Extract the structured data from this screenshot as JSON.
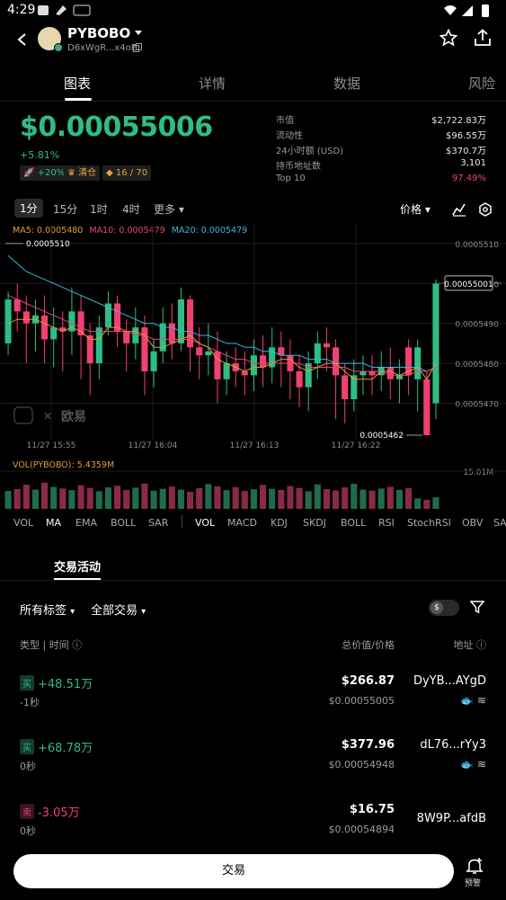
{
  "status": {
    "time": "4:29",
    "icon_names": [
      "media-icon",
      "bird-icon",
      "hms-icon",
      "wifi-icon",
      "signal-icon",
      "battery-icon"
    ]
  },
  "header": {
    "title": "PYBOBO",
    "address": "D6xWgR...x4oE",
    "icons": [
      "back-icon",
      "token-avatar",
      "chevron-down-icon",
      "copy-icon",
      "star-icon",
      "share-icon"
    ]
  },
  "tabs": [
    "图表",
    "详情",
    "数据",
    "风险"
  ],
  "price": {
    "value": "$0.00055006",
    "change": "+5.81%",
    "badges": [
      "+20%",
      "清仓",
      "16 / 70"
    ],
    "accent": "#2ebd85"
  },
  "stats": [
    {
      "label": "市值",
      "value": "$2,722.83万"
    },
    {
      "label": "流动性",
      "value": "$96.55万"
    },
    {
      "label": "24小时额 (USD)",
      "value": "$370.7万"
    },
    {
      "label": "持币地址数",
      "value": "3,101"
    },
    {
      "label": "Top 10",
      "value": "97.49%"
    }
  ],
  "intervals": [
    "1分",
    "15分",
    "1时",
    "4时",
    "更多"
  ],
  "price_mode": "价格",
  "ma_labels": {
    "ma5": "MA5: 0.0005480",
    "ma10": "MA10: 0.0005479",
    "ma20": "MA20: 0.0005479"
  },
  "vol_label": "VOL(PYBOBO): 5.4359M",
  "watermark": "欧易",
  "chart_data": {
    "type": "candlestick",
    "y_ticks": [
      "0.0005510",
      "0.0005500",
      "0.0005490",
      "0.0005480",
      "0.0005470"
    ],
    "ylim": [
      0.0005462,
      0.0005512
    ],
    "x_ticks": [
      "11/27 15:55",
      "11/27 16:04",
      "11/27 16:13",
      "11/27 16:22"
    ],
    "high_label": "0.0005510",
    "low_label": "0.0005462",
    "last_price": "0.00055001",
    "candles": [
      [
        0.0005485,
        0.0005496,
        0.0005498,
        0.0005482,
        1
      ],
      [
        0.0005496,
        0.0005493,
        0.00055,
        0.0005488,
        0
      ],
      [
        0.0005493,
        0.000549,
        0.0005497,
        0.000548,
        0
      ],
      [
        0.000549,
        0.0005492,
        0.0005496,
        0.0005483,
        1
      ],
      [
        0.0005492,
        0.0005486,
        0.0005497,
        0.000548,
        0
      ],
      [
        0.0005486,
        0.0005489,
        0.0005494,
        0.0005479,
        1
      ],
      [
        0.0005489,
        0.0005488,
        0.0005493,
        0.0005478,
        0
      ],
      [
        0.0005488,
        0.0005493,
        0.0005499,
        0.0005482,
        1
      ],
      [
        0.0005493,
        0.0005487,
        0.0005497,
        0.0005476,
        0
      ],
      [
        0.0005487,
        0.000548,
        0.000549,
        0.0005472,
        0
      ],
      [
        0.000548,
        0.0005489,
        0.0005492,
        0.0005476,
        1
      ],
      [
        0.0005489,
        0.0005495,
        0.0005498,
        0.0005487,
        1
      ],
      [
        0.0005495,
        0.0005488,
        0.0005497,
        0.0005484,
        0
      ],
      [
        0.0005488,
        0.0005485,
        0.0005491,
        0.0005478,
        0
      ],
      [
        0.0005485,
        0.0005489,
        0.0005494,
        0.0005481,
        1
      ],
      [
        0.0005489,
        0.0005478,
        0.0005492,
        0.0005472,
        0
      ],
      [
        0.0005478,
        0.0005483,
        0.0005486,
        0.0005474,
        1
      ],
      [
        0.0005483,
        0.000549,
        0.0005494,
        0.000548,
        1
      ],
      [
        0.000549,
        0.0005485,
        0.0005495,
        0.0005481,
        0
      ],
      [
        0.0005485,
        0.0005496,
        0.0005499,
        0.0005483,
        1
      ],
      [
        0.0005496,
        0.0005484,
        0.0005497,
        0.0005478,
        0
      ],
      [
        0.0005484,
        0.0005482,
        0.0005489,
        0.0005476,
        0
      ],
      [
        0.0005482,
        0.0005483,
        0.000549,
        0.0005477,
        1
      ],
      [
        0.0005483,
        0.0005476,
        0.0005488,
        0.000547,
        0
      ],
      [
        0.0005476,
        0.000548,
        0.0005483,
        0.0005472,
        1
      ],
      [
        0.000548,
        0.0005478,
        0.0005484,
        0.0005474,
        0
      ],
      [
        0.0005478,
        0.0005477,
        0.0005483,
        0.0005472,
        0
      ],
      [
        0.0005477,
        0.0005482,
        0.0005486,
        0.0005473,
        1
      ],
      [
        0.0005482,
        0.0005479,
        0.0005487,
        0.0005474,
        0
      ],
      [
        0.0005479,
        0.0005484,
        0.0005489,
        0.0005475,
        1
      ],
      [
        0.0005484,
        0.0005482,
        0.0005488,
        0.0005474,
        0
      ],
      [
        0.0005482,
        0.0005478,
        0.0005486,
        0.0005471,
        0
      ],
      [
        0.0005478,
        0.0005474,
        0.0005482,
        0.0005469,
        0
      ],
      [
        0.0005474,
        0.000548,
        0.0005483,
        0.0005468,
        1
      ],
      [
        0.000548,
        0.0005485,
        0.0005488,
        0.0005476,
        1
      ],
      [
        0.0005485,
        0.0005484,
        0.0005489,
        0.0005478,
        0
      ],
      [
        0.0005484,
        0.0005477,
        0.0005486,
        0.0005466,
        0
      ],
      [
        0.0005477,
        0.0005471,
        0.000548,
        0.0005465,
        0
      ],
      [
        0.0005471,
        0.0005477,
        0.0005481,
        0.0005468,
        1
      ],
      [
        0.0005477,
        0.0005478,
        0.0005482,
        0.0005472,
        1
      ],
      [
        0.0005478,
        0.0005477,
        0.0005482,
        0.0005472,
        0
      ],
      [
        0.0005477,
        0.0005479,
        0.0005483,
        0.0005473,
        1
      ],
      [
        0.0005479,
        0.0005476,
        0.0005484,
        0.0005471,
        0
      ],
      [
        0.0005476,
        0.0005477,
        0.0005481,
        0.000547,
        1
      ],
      [
        0.0005477,
        0.0005484,
        0.0005486,
        0.0005472,
        0
      ],
      [
        0.0005484,
        0.0005476,
        0.0005486,
        0.0005468,
        1
      ],
      [
        0.0005476,
        0.0005462,
        0.0005478,
        0.0005462,
        0
      ],
      [
        0.000547,
        0.00055,
        0.0005501,
        0.0005466,
        1
      ]
    ],
    "ma5": [
      0.000549,
      0.0005491,
      0.0005491,
      0.0005491,
      0.000549,
      0.0005489,
      0.0005488,
      0.0005489,
      0.0005488,
      0.0005486,
      0.0005486,
      0.0005489,
      0.0005489,
      0.0005488,
      0.0005488,
      0.0005487,
      0.0005484,
      0.0005484,
      0.0005485,
      0.0005486,
      0.0005487,
      0.0005485,
      0.0005484,
      0.0005481,
      0.000548,
      0.0005479,
      0.0005478,
      0.0005479,
      0.0005479,
      0.000548,
      0.0005481,
      0.0005481,
      0.0005479,
      0.0005478,
      0.0005479,
      0.000548,
      0.000548,
      0.0005478,
      0.0005476,
      0.0005476,
      0.0005476,
      0.0005478,
      0.0005478,
      0.0005477,
      0.0005478,
      0.0005479,
      0.0005476,
      0.000548
    ],
    "ma10": [
      0.0005497,
      0.0005496,
      0.0005495,
      0.0005494,
      0.0005493,
      0.0005492,
      0.0005491,
      0.000549,
      0.0005489,
      0.0005488,
      0.0005488,
      0.0005488,
      0.0005488,
      0.0005488,
      0.0005487,
      0.0005487,
      0.0005486,
      0.0005486,
      0.0005486,
      0.0005486,
      0.0005486,
      0.0005485,
      0.0005484,
      0.0005483,
      0.0005482,
      0.0005481,
      0.0005481,
      0.000548,
      0.000548,
      0.000548,
      0.000548,
      0.000548,
      0.000548,
      0.0005479,
      0.0005479,
      0.0005479,
      0.0005479,
      0.0005479,
      0.0005478,
      0.0005478,
      0.0005478,
      0.0005478,
      0.0005477,
      0.0005477,
      0.0005477,
      0.0005478,
      0.0005478,
      0.0005479
    ],
    "ma20": [
      0.0005507,
      0.0005505,
      0.0005503,
      0.0005502,
      0.0005501,
      0.00055,
      0.0005499,
      0.0005498,
      0.0005497,
      0.0005496,
      0.0005495,
      0.0005494,
      0.0005493,
      0.0005492,
      0.0005491,
      0.000549,
      0.000549,
      0.0005489,
      0.0005489,
      0.0005488,
      0.0005488,
      0.0005487,
      0.0005487,
      0.0005486,
      0.0005485,
      0.0005485,
      0.0005484,
      0.0005484,
      0.0005483,
      0.0005483,
      0.0005482,
      0.0005482,
      0.0005482,
      0.0005481,
      0.0005481,
      0.0005481,
      0.000548,
      0.000548,
      0.000548,
      0.000548,
      0.0005479,
      0.0005479,
      0.0005479,
      0.0005479,
      0.0005479,
      0.0005479,
      0.0005478,
      0.0005479
    ],
    "vol_tick": "15.01M",
    "volume": [
      6.5,
      7.2,
      8.8,
      7.0,
      9.5,
      8.0,
      7.4,
      6.8,
      8.6,
      7.6,
      6.4,
      7.8,
      8.4,
      6.9,
      7.7,
      9.2,
      6.6,
      7.3,
      8.1,
      7.0,
      6.2,
      7.5,
      9.0,
      8.2,
      6.8,
      7.9,
      6.5,
      7.1,
      8.7,
      7.3,
      6.9,
      8.3,
      7.6,
      6.4,
      8.9,
      7.2,
      6.7,
      7.8,
      9.1,
      7.0,
      6.6,
      7.4,
      8.0,
      6.9,
      7.5,
      3.8,
      3.3,
      4.2
    ]
  },
  "indicators_main": [
    "VOL",
    "MA",
    "EMA",
    "BOLL",
    "SAR"
  ],
  "indicators_sub": [
    "VOL",
    "MACD",
    "KDJ",
    "SKDJ",
    "BOLL",
    "RSI",
    "StochRSI",
    "OBV",
    "SA"
  ],
  "activity": {
    "title": "交易活动",
    "filters": [
      "所有标签",
      "全部交易"
    ],
    "col_type": "类型 | 时间",
    "col_value": "总价值/价格",
    "col_addr": "地址",
    "rows": [
      {
        "side": "买",
        "amount": "+48.51万",
        "ago": "-1秒",
        "total": "$266.87",
        "price": "$0.00055005",
        "addr": "DyYB...AYgD"
      },
      {
        "side": "买",
        "amount": "+68.78万",
        "ago": "0秒",
        "total": "$377.96",
        "price": "$0.00054948",
        "addr": "dL76...rYy3"
      },
      {
        "side": "卖",
        "amount": "-3.05万",
        "ago": "0秒",
        "total": "$16.75",
        "price": "$0.00054894",
        "addr": "8W9P...afdB"
      }
    ]
  },
  "bottom": {
    "trade": "交易",
    "alert": "预警"
  },
  "colors": {
    "up": "#2ebd85",
    "down": "#f0416f",
    "ma5": "#e59a34",
    "ma10": "#e0497c",
    "ma20": "#3fb6d8"
  }
}
